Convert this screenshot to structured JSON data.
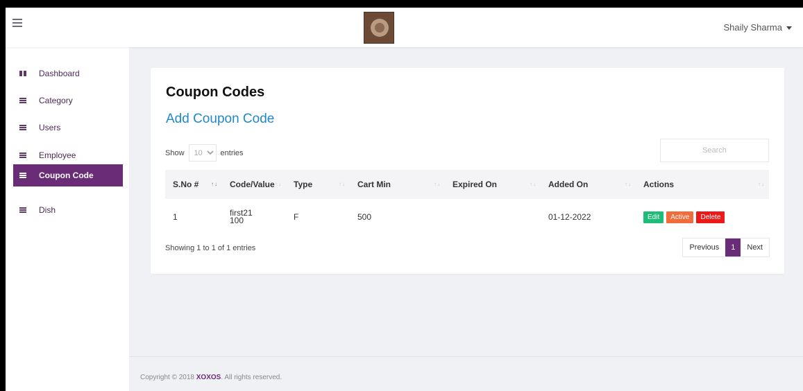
{
  "header": {
    "user_name": "Shaily Sharma"
  },
  "sidebar": {
    "items": [
      {
        "label": "Dashboard",
        "icon": "dashboard-icon"
      },
      {
        "label": "Category",
        "icon": "list-icon"
      },
      {
        "label": "Users",
        "icon": "list-icon"
      },
      {
        "label": "Employee",
        "icon": "list-icon"
      },
      {
        "label": "Coupon Code",
        "icon": "list-icon",
        "active": true
      },
      {
        "label": "Dish",
        "icon": "list-icon"
      }
    ]
  },
  "main": {
    "title": "Coupon Codes",
    "add_link": "Add Coupon Code",
    "show_label": "Show",
    "entries_value": "10",
    "entries_label": "entries",
    "search_placeholder": "Search",
    "columns": [
      "S.No #",
      "Code/Value",
      "Type",
      "Cart Min",
      "Expired On",
      "Added On",
      "Actions"
    ],
    "rows": [
      {
        "sno": "1",
        "code": "first21",
        "value": "100",
        "type": "F",
        "cart_min": "500",
        "expired_on": "",
        "added_on": "01-12-2022"
      }
    ],
    "actions": {
      "edit": "Edit",
      "active": "Active",
      "delete": "Delete"
    },
    "info": {
      "prefix": "Showing ",
      "from": "1",
      "to_word": " to ",
      "to": "1",
      "of_word": " of ",
      "total": "1",
      "suffix": " entries"
    },
    "pager": {
      "previous": "Previous",
      "current": "1",
      "next": "Next"
    }
  },
  "footer": {
    "prefix": "Copyright © 2018 ",
    "brand": "XOXOS",
    "suffix": ". All rights reserved."
  },
  "colors": {
    "accent": "#6a2c77",
    "link": "#1e88c9",
    "edit": "#1fbb78",
    "active": "#f26b3a",
    "delete": "#ea1a1a"
  }
}
